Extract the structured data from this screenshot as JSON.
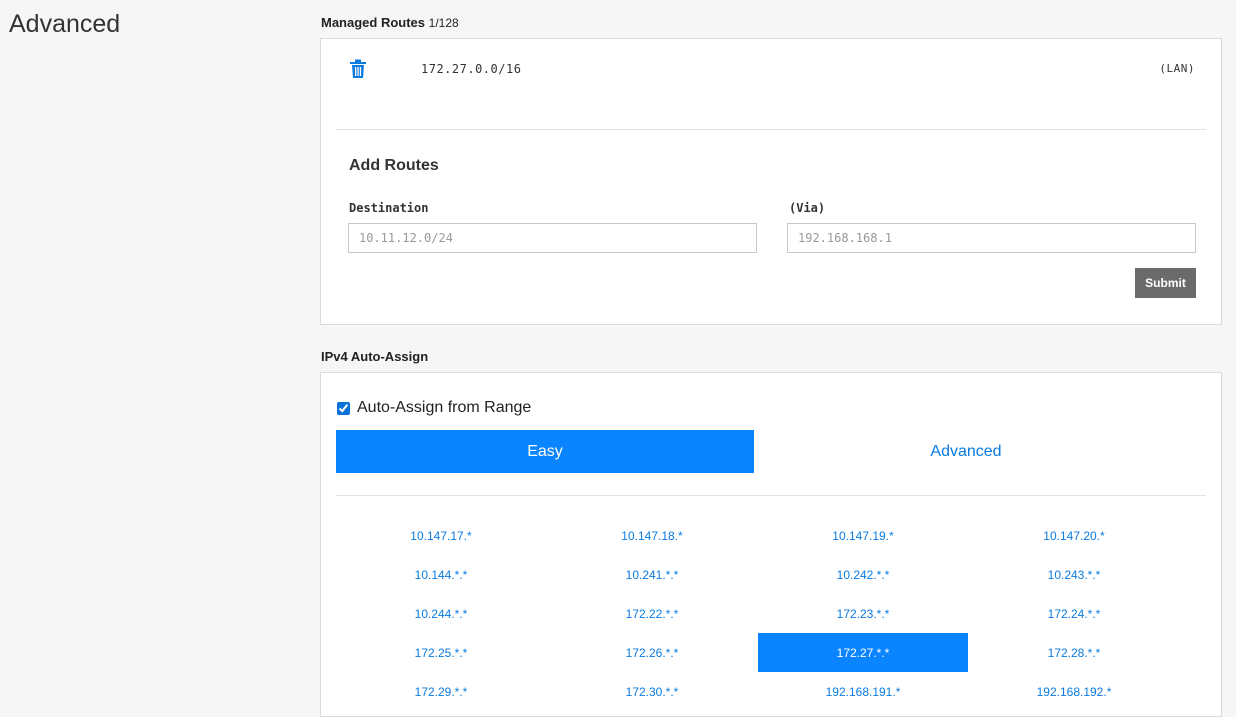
{
  "page": {
    "heading": "Advanced"
  },
  "managed_routes": {
    "title": "Managed Routes",
    "count": "1/128",
    "routes": [
      {
        "destination": "172.27.0.0/16",
        "via": "(LAN)",
        "delete_icon": "trash-icon"
      }
    ]
  },
  "add_routes": {
    "title": "Add Routes",
    "destination_label": "Destination",
    "destination_placeholder": "10.11.12.0/24",
    "via_label": "(Via)",
    "via_placeholder": "192.168.168.1",
    "submit_label": "Submit"
  },
  "ipv4": {
    "title": "IPv4 Auto-Assign",
    "auto_assign_label": "Auto-Assign from Range",
    "auto_assign_checked": true,
    "tabs": [
      {
        "label": "Easy",
        "active": true
      },
      {
        "label": "Advanced",
        "active": false
      }
    ],
    "ranges": [
      "10.147.17.*",
      "10.147.18.*",
      "10.147.19.*",
      "10.147.20.*",
      "10.144.*.*",
      "10.241.*.*",
      "10.242.*.*",
      "10.243.*.*",
      "10.244.*.*",
      "172.22.*.*",
      "172.23.*.*",
      "172.24.*.*",
      "172.25.*.*",
      "172.26.*.*",
      "172.27.*.*",
      "172.28.*.*",
      "172.29.*.*",
      "172.30.*.*",
      "192.168.191.*",
      "192.168.192.*"
    ],
    "selected_range": "172.27.*.*"
  },
  "colors": {
    "accent": "#0a84ff",
    "link": "#0a7be0",
    "submit_bg": "#6b6b6b"
  }
}
